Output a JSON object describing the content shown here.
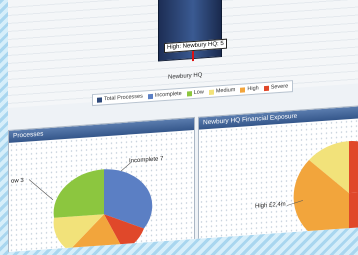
{
  "tooltip": {
    "text": "High: Newbury HQ: 5"
  },
  "chart": {
    "category_label": "Newbury HQ"
  },
  "legend": {
    "items": [
      {
        "label": "Total Processes",
        "color": "#2f4a7a"
      },
      {
        "label": "Incomplete",
        "color": "#5b7fc4"
      },
      {
        "label": "Low",
        "color": "#8cc63f"
      },
      {
        "label": "Medium",
        "color": "#f2e27a"
      },
      {
        "label": "High",
        "color": "#f2a53c"
      },
      {
        "label": "Severe",
        "color": "#e0482a"
      }
    ]
  },
  "left_panel": {
    "title": "Processes",
    "labels": {
      "incomplete": "Incomplete 7",
      "left": "ow 3"
    }
  },
  "right_panel": {
    "title": "Newbury HQ Financial Exposure",
    "labels": {
      "high": "High £2,4m"
    }
  }
}
